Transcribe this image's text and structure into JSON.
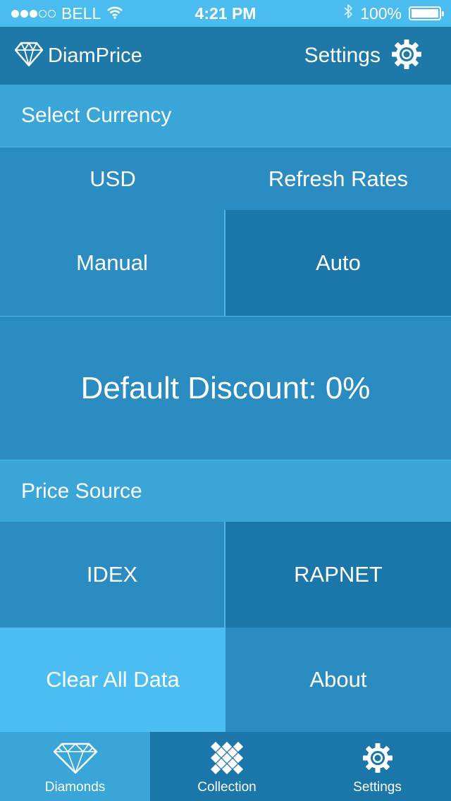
{
  "status_bar": {
    "carrier": "BELL",
    "time": "4:21 PM",
    "battery": "100%",
    "signal_filled": 3,
    "signal_total": 5
  },
  "nav": {
    "brand": "DiamPrice",
    "settings_label": "Settings"
  },
  "currency": {
    "header": "Select Currency",
    "selected": "USD",
    "refresh_label": "Refresh Rates",
    "manual_label": "Manual",
    "auto_label": "Auto"
  },
  "discount": {
    "label": "Default Discount: 0%"
  },
  "price_source": {
    "header": "Price Source",
    "option_1": "IDEX",
    "option_2": "RAPNET"
  },
  "actions": {
    "clear_label": "Clear All Data",
    "about_label": "About"
  },
  "tabs": [
    {
      "label": "Diamonds",
      "icon": "diamond-icon"
    },
    {
      "label": "Collection",
      "icon": "grid-icon"
    },
    {
      "label": "Settings",
      "icon": "gear-icon"
    }
  ],
  "colors": {
    "status_bar": "#4bbcf0",
    "nav_bar": "#1e78a8",
    "section_header": "#3aa6d8",
    "light_cell": "#2a8cc0",
    "dark_cell": "#1b76aa",
    "bright_cell": "#4bbdf2"
  }
}
